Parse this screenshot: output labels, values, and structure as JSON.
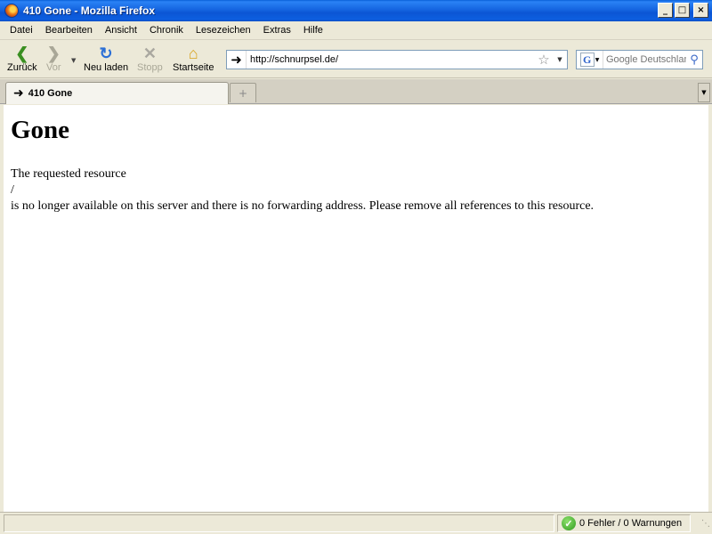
{
  "window": {
    "title": "410 Gone - Mozilla Firefox",
    "minimize_glyph": "_",
    "maximize_glyph": "□",
    "close_glyph": "×"
  },
  "menu": {
    "items": [
      "Datei",
      "Bearbeiten",
      "Ansicht",
      "Chronik",
      "Lesezeichen",
      "Extras",
      "Hilfe"
    ]
  },
  "toolbar": {
    "back_label": "Zurück",
    "forward_label": "Vor",
    "reload_label": "Neu laden",
    "stop_label": "Stopp",
    "home_label": "Startseite"
  },
  "urlbar": {
    "value": "http://schnurpsel.de/"
  },
  "search": {
    "placeholder": "Google Deutschland"
  },
  "tabs": [
    {
      "label": "410 Gone",
      "icon": "arrow-right-icon",
      "active": true
    }
  ],
  "page": {
    "heading": "Gone",
    "line1": "The requested resource",
    "line2": "/",
    "line3": "is no longer available on this server and there is no forwarding address. Please remove all references to this resource."
  },
  "status": {
    "main_text": "",
    "validator_text": "0 Fehler / 0 Warnungen"
  },
  "colors": {
    "titlebar": "#0b55d4",
    "chrome": "#ece9d8",
    "back_arrow": "#3a8f21",
    "reload": "#2b6fd6",
    "check": "#2f9b1f"
  }
}
